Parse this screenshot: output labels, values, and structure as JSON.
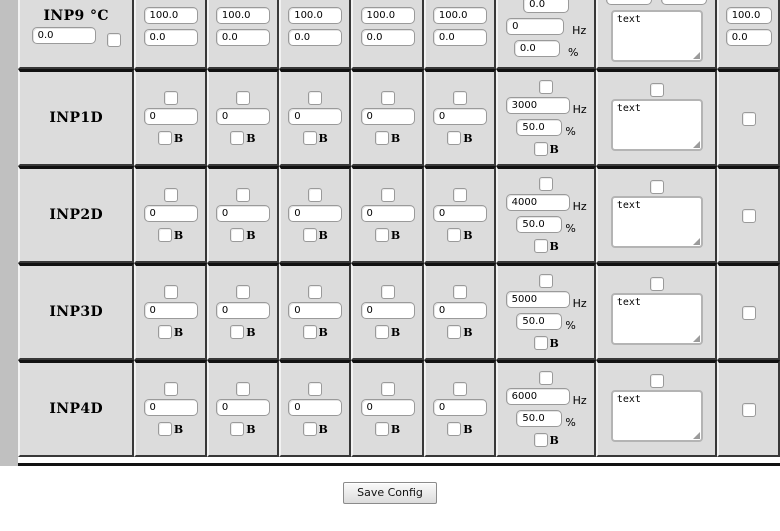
{
  "page": {
    "save_button_label": "Save Config"
  },
  "table": {
    "analog_row": {
      "label": "INP9 °C",
      "span_value": "0.0",
      "span_checkbox": "unchecked",
      "columns": [
        {
          "high": "100.0",
          "low": "0.0"
        },
        {
          "high": "100.0",
          "low": "0.0"
        },
        {
          "high": "100.0",
          "low": "0.0"
        },
        {
          "high": "100.0",
          "low": "0.0"
        },
        {
          "high": "100.0",
          "low": "0.0"
        }
      ],
      "freq_cell": {
        "top_value": "0.0",
        "hz_value": "0",
        "hz_unit": "Hz",
        "duty_value": "0.0",
        "duty_unit": "%"
      },
      "note_cell": {
        "clipped_field_1": "",
        "clipped_field_2": "",
        "text": "text"
      },
      "last_column": {
        "high": "100.0",
        "low": "0.0"
      }
    },
    "digital_rows": [
      {
        "label": "INP1D",
        "columns": [
          {
            "checkbox": "unchecked",
            "value": "0",
            "b_checkbox": "unchecked",
            "b_label": "B"
          },
          {
            "checkbox": "unchecked",
            "value": "0",
            "b_checkbox": "unchecked",
            "b_label": "B"
          },
          {
            "checkbox": "unchecked",
            "value": "0",
            "b_checkbox": "unchecked",
            "b_label": "B"
          },
          {
            "checkbox": "unchecked",
            "value": "0",
            "b_checkbox": "unchecked",
            "b_label": "B"
          },
          {
            "checkbox": "unchecked",
            "value": "0",
            "b_checkbox": "unchecked",
            "b_label": "B"
          }
        ],
        "freq_cell": {
          "enable_checkbox": "unchecked",
          "hz_value": "3000",
          "hz_unit": "Hz",
          "duty_value": "50.0",
          "duty_unit": "%",
          "b_checkbox": "unchecked",
          "b_label": "B"
        },
        "note_cell": {
          "checkbox": "unchecked",
          "text": "text"
        },
        "last_column": {
          "checkbox": "unchecked"
        }
      },
      {
        "label": "INP2D",
        "columns": [
          {
            "checkbox": "unchecked",
            "value": "0",
            "b_checkbox": "unchecked",
            "b_label": "B"
          },
          {
            "checkbox": "unchecked",
            "value": "0",
            "b_checkbox": "unchecked",
            "b_label": "B"
          },
          {
            "checkbox": "unchecked",
            "value": "0",
            "b_checkbox": "unchecked",
            "b_label": "B"
          },
          {
            "checkbox": "unchecked",
            "value": "0",
            "b_checkbox": "unchecked",
            "b_label": "B"
          },
          {
            "checkbox": "unchecked",
            "value": "0",
            "b_checkbox": "unchecked",
            "b_label": "B"
          }
        ],
        "freq_cell": {
          "enable_checkbox": "unchecked",
          "hz_value": "4000",
          "hz_unit": "Hz",
          "duty_value": "50.0",
          "duty_unit": "%",
          "b_checkbox": "unchecked",
          "b_label": "B"
        },
        "note_cell": {
          "checkbox": "unchecked",
          "text": "text"
        },
        "last_column": {
          "checkbox": "unchecked"
        }
      },
      {
        "label": "INP3D",
        "columns": [
          {
            "checkbox": "unchecked",
            "value": "0",
            "b_checkbox": "unchecked",
            "b_label": "B"
          },
          {
            "checkbox": "unchecked",
            "value": "0",
            "b_checkbox": "unchecked",
            "b_label": "B"
          },
          {
            "checkbox": "unchecked",
            "value": "0",
            "b_checkbox": "unchecked",
            "b_label": "B"
          },
          {
            "checkbox": "unchecked",
            "value": "0",
            "b_checkbox": "unchecked",
            "b_label": "B"
          },
          {
            "checkbox": "unchecked",
            "value": "0",
            "b_checkbox": "unchecked",
            "b_label": "B"
          }
        ],
        "freq_cell": {
          "enable_checkbox": "unchecked",
          "hz_value": "5000",
          "hz_unit": "Hz",
          "duty_value": "50.0",
          "duty_unit": "%",
          "b_checkbox": "unchecked",
          "b_label": "B"
        },
        "note_cell": {
          "checkbox": "unchecked",
          "text": "text"
        },
        "last_column": {
          "checkbox": "unchecked"
        }
      },
      {
        "label": "INP4D",
        "columns": [
          {
            "checkbox": "unchecked",
            "value": "0",
            "b_checkbox": "unchecked",
            "b_label": "B"
          },
          {
            "checkbox": "unchecked",
            "value": "0",
            "b_checkbox": "unchecked",
            "b_label": "B"
          },
          {
            "checkbox": "unchecked",
            "value": "0",
            "b_checkbox": "unchecked",
            "b_label": "B"
          },
          {
            "checkbox": "unchecked",
            "value": "0",
            "b_checkbox": "unchecked",
            "b_label": "B"
          },
          {
            "checkbox": "unchecked",
            "value": "0",
            "b_checkbox": "unchecked",
            "b_label": "B"
          }
        ],
        "freq_cell": {
          "enable_checkbox": "unchecked",
          "hz_value": "6000",
          "hz_unit": "Hz",
          "duty_value": "50.0",
          "duty_unit": "%",
          "b_checkbox": "unchecked",
          "b_label": "B"
        },
        "note_cell": {
          "checkbox": "unchecked",
          "text": "text"
        },
        "last_column": {
          "checkbox": "unchecked"
        }
      }
    ]
  },
  "colors": {
    "cell_background": "#dcdcdc",
    "page_background": "#ffffff",
    "gutter": "#c0c0c0",
    "border_dark": "#111111",
    "field_background": "#ffffff"
  }
}
